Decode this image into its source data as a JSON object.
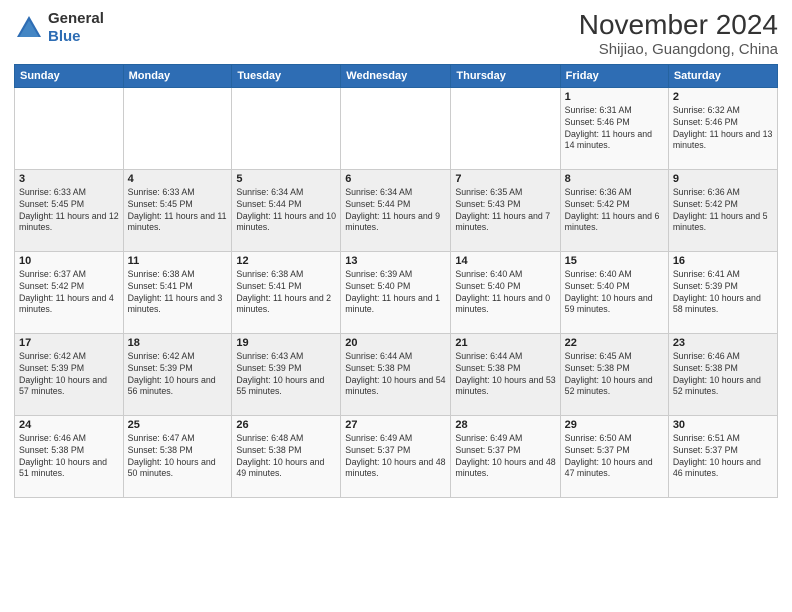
{
  "logo": {
    "general": "General",
    "blue": "Blue"
  },
  "title": "November 2024",
  "subtitle": "Shijiao, Guangdong, China",
  "weekdays": [
    "Sunday",
    "Monday",
    "Tuesday",
    "Wednesday",
    "Thursday",
    "Friday",
    "Saturday"
  ],
  "weeks": [
    [
      {
        "day": "",
        "info": ""
      },
      {
        "day": "",
        "info": ""
      },
      {
        "day": "",
        "info": ""
      },
      {
        "day": "",
        "info": ""
      },
      {
        "day": "",
        "info": ""
      },
      {
        "day": "1",
        "info": "Sunrise: 6:31 AM\nSunset: 5:46 PM\nDaylight: 11 hours and 14 minutes."
      },
      {
        "day": "2",
        "info": "Sunrise: 6:32 AM\nSunset: 5:46 PM\nDaylight: 11 hours and 13 minutes."
      }
    ],
    [
      {
        "day": "3",
        "info": "Sunrise: 6:33 AM\nSunset: 5:45 PM\nDaylight: 11 hours and 12 minutes."
      },
      {
        "day": "4",
        "info": "Sunrise: 6:33 AM\nSunset: 5:45 PM\nDaylight: 11 hours and 11 minutes."
      },
      {
        "day": "5",
        "info": "Sunrise: 6:34 AM\nSunset: 5:44 PM\nDaylight: 11 hours and 10 minutes."
      },
      {
        "day": "6",
        "info": "Sunrise: 6:34 AM\nSunset: 5:44 PM\nDaylight: 11 hours and 9 minutes."
      },
      {
        "day": "7",
        "info": "Sunrise: 6:35 AM\nSunset: 5:43 PM\nDaylight: 11 hours and 7 minutes."
      },
      {
        "day": "8",
        "info": "Sunrise: 6:36 AM\nSunset: 5:42 PM\nDaylight: 11 hours and 6 minutes."
      },
      {
        "day": "9",
        "info": "Sunrise: 6:36 AM\nSunset: 5:42 PM\nDaylight: 11 hours and 5 minutes."
      }
    ],
    [
      {
        "day": "10",
        "info": "Sunrise: 6:37 AM\nSunset: 5:42 PM\nDaylight: 11 hours and 4 minutes."
      },
      {
        "day": "11",
        "info": "Sunrise: 6:38 AM\nSunset: 5:41 PM\nDaylight: 11 hours and 3 minutes."
      },
      {
        "day": "12",
        "info": "Sunrise: 6:38 AM\nSunset: 5:41 PM\nDaylight: 11 hours and 2 minutes."
      },
      {
        "day": "13",
        "info": "Sunrise: 6:39 AM\nSunset: 5:40 PM\nDaylight: 11 hours and 1 minute."
      },
      {
        "day": "14",
        "info": "Sunrise: 6:40 AM\nSunset: 5:40 PM\nDaylight: 11 hours and 0 minutes."
      },
      {
        "day": "15",
        "info": "Sunrise: 6:40 AM\nSunset: 5:40 PM\nDaylight: 10 hours and 59 minutes."
      },
      {
        "day": "16",
        "info": "Sunrise: 6:41 AM\nSunset: 5:39 PM\nDaylight: 10 hours and 58 minutes."
      }
    ],
    [
      {
        "day": "17",
        "info": "Sunrise: 6:42 AM\nSunset: 5:39 PM\nDaylight: 10 hours and 57 minutes."
      },
      {
        "day": "18",
        "info": "Sunrise: 6:42 AM\nSunset: 5:39 PM\nDaylight: 10 hours and 56 minutes."
      },
      {
        "day": "19",
        "info": "Sunrise: 6:43 AM\nSunset: 5:39 PM\nDaylight: 10 hours and 55 minutes."
      },
      {
        "day": "20",
        "info": "Sunrise: 6:44 AM\nSunset: 5:38 PM\nDaylight: 10 hours and 54 minutes."
      },
      {
        "day": "21",
        "info": "Sunrise: 6:44 AM\nSunset: 5:38 PM\nDaylight: 10 hours and 53 minutes."
      },
      {
        "day": "22",
        "info": "Sunrise: 6:45 AM\nSunset: 5:38 PM\nDaylight: 10 hours and 52 minutes."
      },
      {
        "day": "23",
        "info": "Sunrise: 6:46 AM\nSunset: 5:38 PM\nDaylight: 10 hours and 52 minutes."
      }
    ],
    [
      {
        "day": "24",
        "info": "Sunrise: 6:46 AM\nSunset: 5:38 PM\nDaylight: 10 hours and 51 minutes."
      },
      {
        "day": "25",
        "info": "Sunrise: 6:47 AM\nSunset: 5:38 PM\nDaylight: 10 hours and 50 minutes."
      },
      {
        "day": "26",
        "info": "Sunrise: 6:48 AM\nSunset: 5:38 PM\nDaylight: 10 hours and 49 minutes."
      },
      {
        "day": "27",
        "info": "Sunrise: 6:49 AM\nSunset: 5:37 PM\nDaylight: 10 hours and 48 minutes."
      },
      {
        "day": "28",
        "info": "Sunrise: 6:49 AM\nSunset: 5:37 PM\nDaylight: 10 hours and 48 minutes."
      },
      {
        "day": "29",
        "info": "Sunrise: 6:50 AM\nSunset: 5:37 PM\nDaylight: 10 hours and 47 minutes."
      },
      {
        "day": "30",
        "info": "Sunrise: 6:51 AM\nSunset: 5:37 PM\nDaylight: 10 hours and 46 minutes."
      }
    ]
  ]
}
